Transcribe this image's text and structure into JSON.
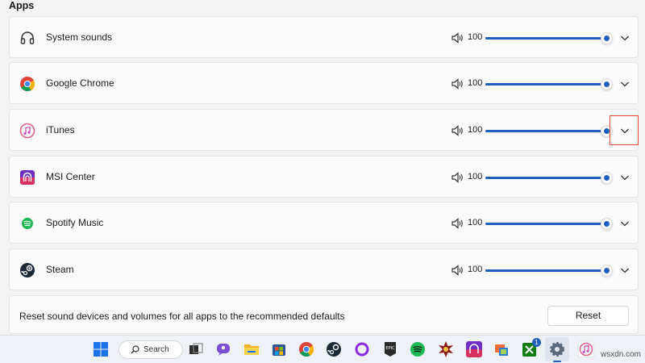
{
  "section_title": "Apps",
  "apps": [
    {
      "name": "System sounds",
      "icon": "headphones-icon",
      "volume": 100
    },
    {
      "name": "Google Chrome",
      "icon": "chrome-icon",
      "volume": 100
    },
    {
      "name": "iTunes",
      "icon": "itunes-icon",
      "volume": 100
    },
    {
      "name": "MSI Center",
      "icon": "msi-center-icon",
      "volume": 100
    },
    {
      "name": "Spotify Music",
      "icon": "spotify-icon",
      "volume": 100
    },
    {
      "name": "Steam",
      "icon": "steam-icon",
      "volume": 100
    }
  ],
  "reset": {
    "description": "Reset sound devices and volumes for all apps to the recommended defaults",
    "button_label": "Reset"
  },
  "taskbar": {
    "search_label": "Search",
    "xbox_badge": "1",
    "items": [
      "start-icon",
      "search",
      "task-view-icon",
      "chat-icon",
      "file-explorer-icon",
      "store-icon",
      "chrome-icon",
      "steam-icon",
      "cortana-icon",
      "epic-games-icon",
      "spotify-icon",
      "game-icon",
      "msi-center-icon",
      "snipping-icon",
      "xbox-icon",
      "settings-icon",
      "itunes-icon"
    ]
  },
  "watermark": "wsxdn.com",
  "colors": {
    "accent": "#1f5fbf",
    "highlight": "#e0463f"
  }
}
